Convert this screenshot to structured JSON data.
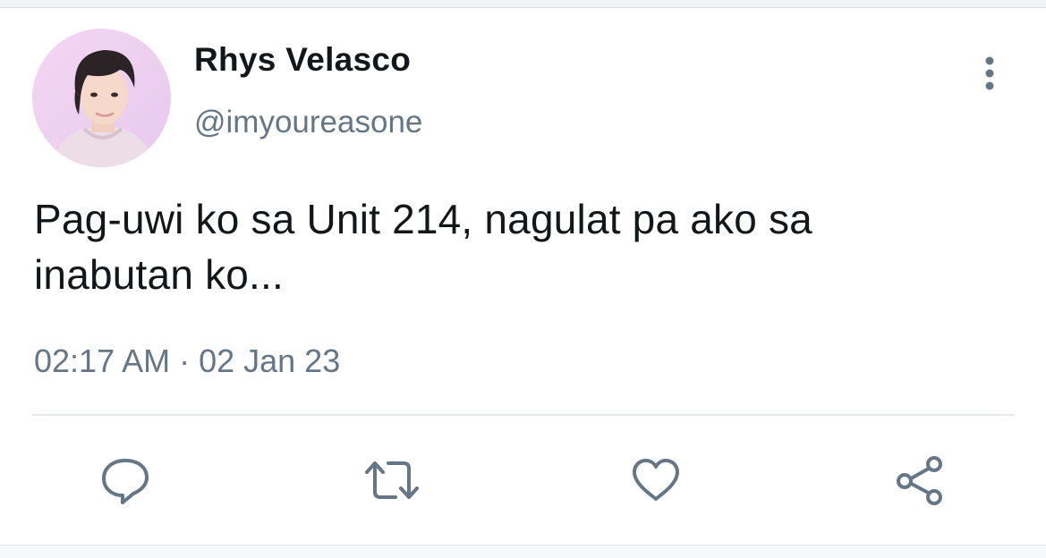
{
  "tweet": {
    "display_name": "Rhys Velasco",
    "handle": "@imyoureasone",
    "text_line1": "Pag-uwi ko sa Unit 214, nagulat pa ako sa",
    "text_line2": "inabutan ko...",
    "timestamp": "02:17 AM · 02 Jan 23"
  },
  "icons": {
    "avatar": "profile-photo",
    "more": "vertical-ellipsis-icon",
    "reply": "speech-bubble-icon",
    "retweet": "retweet-arrows-icon",
    "like": "heart-outline-icon",
    "share": "share-nodes-icon"
  },
  "colors": {
    "text_primary": "#14171a",
    "text_secondary": "#657786",
    "icon": "#657786",
    "divider": "#e6ecf0"
  }
}
